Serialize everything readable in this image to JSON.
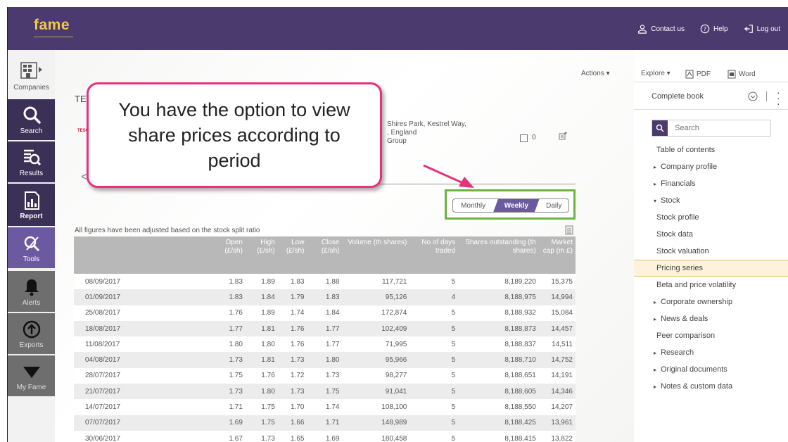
{
  "header": {
    "logo": "fame",
    "links": [
      {
        "label": "Contact us",
        "icon": "person-icon"
      },
      {
        "label": "Help",
        "icon": "help-icon"
      },
      {
        "label": "Log out",
        "icon": "logout-icon"
      }
    ]
  },
  "sidebar": {
    "items": [
      {
        "label": "Companies",
        "icon": "companies-icon"
      },
      {
        "label": "Search",
        "icon": "search-icon"
      },
      {
        "label": "Results",
        "icon": "results-icon"
      },
      {
        "label": "Report",
        "icon": "report-icon"
      },
      {
        "label": "Tools",
        "icon": "tools-icon"
      },
      {
        "label": "Alerts",
        "icon": "bell-icon"
      },
      {
        "label": "Exports",
        "icon": "export-icon"
      },
      {
        "label": "My Fame",
        "icon": "myfame-icon"
      }
    ]
  },
  "toolbar": {
    "actions": "Actions ▾",
    "explore": "Explore ▾",
    "pdf": "PDF",
    "word": "Word"
  },
  "company": {
    "title": "TE",
    "logo_text": "TESCO",
    "address_lines": [
      "Shires Park, Kestrel Way,",
      ", England",
      "Group"
    ],
    "count": "0"
  },
  "callout": {
    "text": "You have the option to view share prices according to period"
  },
  "period": {
    "options": [
      "Monthly",
      "Weekly",
      "Daily"
    ],
    "selected": "Weekly"
  },
  "note": "All figures have been adjusted based on the stock split ratio",
  "table": {
    "headers": [
      "",
      "Open (£/sh)",
      "High (£/sh)",
      "Low (£/sh)",
      "Close (£/sh)",
      "Volume (th shares)",
      "No of days traded",
      "Shares outstanding (th shares)",
      "Market cap (m £)"
    ],
    "rows": [
      [
        "08/09/2017",
        "1.83",
        "1.89",
        "1.83",
        "1.88",
        "117,721",
        "5",
        "8,189,220",
        "15,375"
      ],
      [
        "01/09/2017",
        "1.83",
        "1.84",
        "1.79",
        "1.83",
        "95,126",
        "4",
        "8,188,975",
        "14,994"
      ],
      [
        "25/08/2017",
        "1.76",
        "1.89",
        "1.74",
        "1.84",
        "172,874",
        "5",
        "8,188,932",
        "15,084"
      ],
      [
        "18/08/2017",
        "1.77",
        "1.81",
        "1.76",
        "1.77",
        "102,409",
        "5",
        "8,188,873",
        "14,457"
      ],
      [
        "11/08/2017",
        "1.80",
        "1.80",
        "1.76",
        "1.77",
        "71,995",
        "5",
        "8,188,837",
        "14,511"
      ],
      [
        "04/08/2017",
        "1.73",
        "1.81",
        "1.73",
        "1.80",
        "95,966",
        "5",
        "8,188,710",
        "14,752"
      ],
      [
        "28/07/2017",
        "1.75",
        "1.76",
        "1.72",
        "1.73",
        "98,277",
        "5",
        "8,188,651",
        "14,191"
      ],
      [
        "21/07/2017",
        "1.73",
        "1.80",
        "1.73",
        "1.75",
        "91,041",
        "5",
        "8,188,605",
        "14,346"
      ],
      [
        "14/07/2017",
        "1.71",
        "1.75",
        "1.70",
        "1.74",
        "108,100",
        "5",
        "8,188,550",
        "14,207"
      ],
      [
        "07/07/2017",
        "1.69",
        "1.75",
        "1.66",
        "1.71",
        "148,989",
        "5",
        "8,188,425",
        "13,961"
      ],
      [
        "30/06/2017",
        "1.67",
        "1.73",
        "1.65",
        "1.69",
        "180,458",
        "5",
        "8,188,415",
        "13,822"
      ]
    ]
  },
  "right_panel": {
    "book": "Complete book",
    "search_placeholder": "Search",
    "toc": [
      {
        "label": "Table of contents",
        "expander": ""
      },
      {
        "label": "Company profile",
        "expander": "▸"
      },
      {
        "label": "Financials",
        "expander": "▸"
      },
      {
        "label": "Stock",
        "expander": "▾"
      },
      {
        "label": "Stock profile",
        "expander": ""
      },
      {
        "label": "Stock data",
        "expander": ""
      },
      {
        "label": "Stock valuation",
        "expander": ""
      },
      {
        "label": "Pricing series",
        "expander": "",
        "selected": true
      },
      {
        "label": "Beta and price volatility",
        "expander": ""
      },
      {
        "label": "Corporate ownership",
        "expander": "▸"
      },
      {
        "label": "News & deals",
        "expander": "▸"
      },
      {
        "label": "Peer comparison",
        "expander": ""
      },
      {
        "label": "Research",
        "expander": "▸"
      },
      {
        "label": "Original documents",
        "expander": "▸"
      },
      {
        "label": "Notes & custom data",
        "expander": "▸"
      }
    ]
  },
  "colors": {
    "header_bg": "#4a3a6e",
    "logo": "#f2c94c",
    "callout_border": "#e6317f",
    "period_box": "#6db33f",
    "selected_toc": "#fdf3da"
  }
}
